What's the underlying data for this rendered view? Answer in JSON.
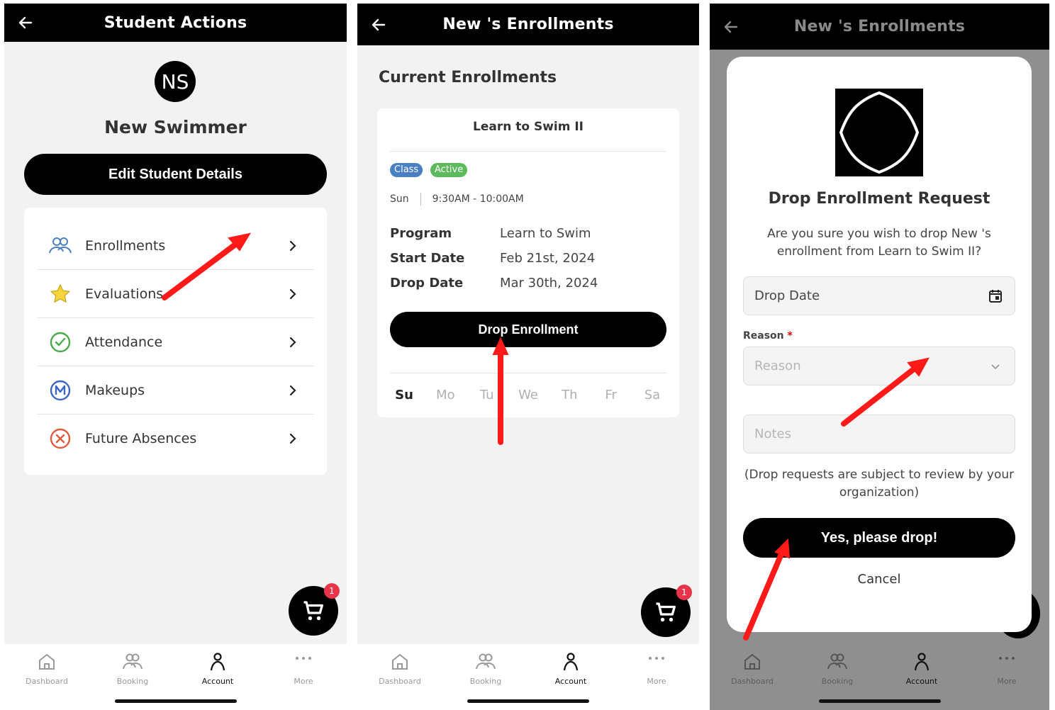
{
  "panel1": {
    "title": "Student Actions",
    "avatar_initials": "NS",
    "student_name": "New  Swimmer",
    "edit_button": "Edit Student Details",
    "menu": [
      {
        "label": "Enrollments",
        "icon": "people-icon"
      },
      {
        "label": "Evaluations",
        "icon": "star-icon"
      },
      {
        "label": "Attendance",
        "icon": "check-circle-icon"
      },
      {
        "label": "Makeups",
        "icon": "m-circle-icon"
      },
      {
        "label": "Future Absences",
        "icon": "x-circle-icon"
      }
    ],
    "cart_badge": "1"
  },
  "panel2": {
    "title": "New 's Enrollments",
    "section_title": "Current Enrollments",
    "class_name": "Learn to Swim II",
    "pill_class": "Class",
    "pill_active": "Active",
    "day": "Sun",
    "time": "9:30AM - 10:00AM",
    "details": [
      {
        "key": "Program",
        "value": "Learn to Swim"
      },
      {
        "key": "Start Date",
        "value": "Feb 21st, 2024"
      },
      {
        "key": "Drop Date",
        "value": "Mar 30th, 2024"
      }
    ],
    "drop_button": "Drop Enrollment",
    "days": [
      "Su",
      "Mo",
      "Tu",
      "We",
      "Th",
      "Fr",
      "Sa"
    ],
    "cart_badge": "1"
  },
  "panel3": {
    "title": "New 's Enrollments",
    "modal_title": "Drop Enrollment Request",
    "message": "Are you sure you wish to drop New 's enrollment from Learn to Swim II?",
    "drop_date_placeholder": "Drop Date",
    "reason_label": "Reason",
    "reason_required": "*",
    "reason_placeholder": "Reason",
    "notes_placeholder": "Notes",
    "disclaimer": "(Drop requests are subject to review by your organization)",
    "confirm_button": "Yes, please drop!",
    "cancel": "Cancel"
  },
  "tabs": [
    "Dashboard",
    "Booking",
    "Account",
    "More"
  ],
  "colors": {
    "accent": "#000000",
    "arrow": "#ff1a1a",
    "pill_class": "#4a7fc1",
    "pill_active": "#5cba5c",
    "badge": "#e8344a"
  }
}
